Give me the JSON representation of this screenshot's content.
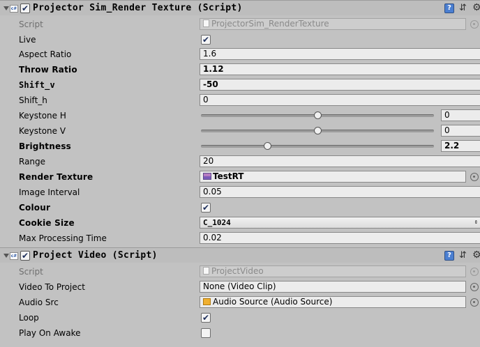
{
  "components": [
    {
      "title": "Projector Sim_Render Texture (Script)",
      "enabled": true,
      "script_label": "Script",
      "script_value": "ProjectorSim_RenderTexture",
      "fields": {
        "live": {
          "label": "Live",
          "checked": true
        },
        "aspect_ratio": {
          "label": "Aspect Ratio",
          "value": "1.6"
        },
        "throw_ratio": {
          "label": "Throw Ratio",
          "value": "1.12"
        },
        "shift_v": {
          "label": "Shift_v",
          "value": "-50"
        },
        "shift_h": {
          "label": "Shift_h",
          "value": "0"
        },
        "keystone_h": {
          "label": "Keystone H",
          "value": "0",
          "slider_fraction": 0.5
        },
        "keystone_v": {
          "label": "Keystone V",
          "value": "0",
          "slider_fraction": 0.5
        },
        "brightness": {
          "label": "Brightness",
          "value": "2.2",
          "slider_fraction": 0.28
        },
        "range": {
          "label": "Range",
          "value": "20"
        },
        "render_texture": {
          "label": "Render Texture",
          "value": "TestRT"
        },
        "image_interval": {
          "label": "Image Interval",
          "value": "0.05"
        },
        "colour": {
          "label": "Colour",
          "checked": true
        },
        "cookie_size": {
          "label": "Cookie Size",
          "value": "C_1024"
        },
        "max_processing_time": {
          "label": "Max Processing Time",
          "value": "0.02"
        }
      }
    },
    {
      "title": "Project Video (Script)",
      "enabled": true,
      "script_label": "Script",
      "script_value": "ProjectVideo",
      "fields": {
        "video_to_project": {
          "label": "Video To Project",
          "value": "None (Video Clip)"
        },
        "audio_src": {
          "label": "Audio Src",
          "value": "Audio Source (Audio Source)"
        },
        "loop": {
          "label": "Loop",
          "checked": true
        },
        "play_on_awake": {
          "label": "Play On Awake",
          "checked": false
        }
      }
    }
  ],
  "icons": {
    "checkmark": "✔",
    "help": "?",
    "preset": "⇵",
    "gear": "⚙",
    "dropdown_arrow": "⇕",
    "script": "c#"
  },
  "colors": {
    "background": "#c2c2c2",
    "field": "#ececec",
    "header": "#bdbdbd",
    "help_icon": "#4b7fd1"
  }
}
